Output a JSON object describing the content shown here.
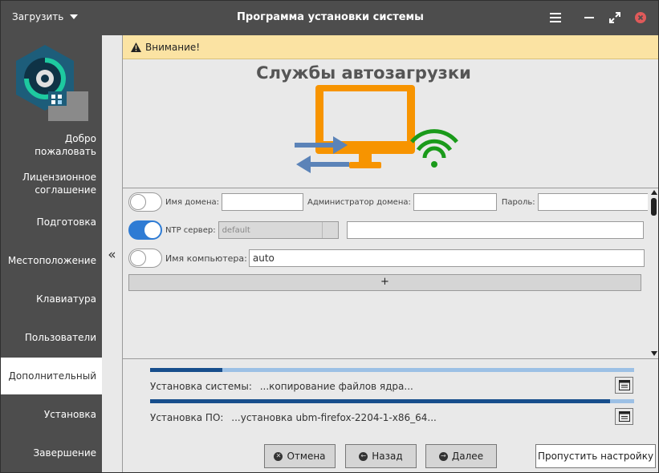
{
  "titlebar": {
    "menu_label": "Загрузить",
    "title": "Программа установки системы"
  },
  "sidebar": {
    "items": [
      {
        "label": "Добро пожаловать"
      },
      {
        "label": "Лицензионное соглашение"
      },
      {
        "label": "Подготовка"
      },
      {
        "label": "Местоположение"
      },
      {
        "label": "Клавиатура"
      },
      {
        "label": "Пользователи"
      },
      {
        "label": "Дополнительный",
        "active": true
      },
      {
        "label": "Установка"
      },
      {
        "label": "Завершение"
      }
    ],
    "collapse_glyph": "«"
  },
  "warning": {
    "text": "Внимание!"
  },
  "hero": {
    "title": "Службы автозагрузки"
  },
  "form": {
    "domain": {
      "enabled": false,
      "domain_label": "Имя домена:",
      "domain_value": "",
      "admin_label": "Администратор домена:",
      "admin_value": "",
      "password_label": "Пароль:",
      "password_value": ""
    },
    "ntp": {
      "enabled": true,
      "label": "NTP сервер:",
      "select_value": "default",
      "custom_value": ""
    },
    "hostname": {
      "enabled": false,
      "label": "Имя компьютера:",
      "value": "auto"
    },
    "add_label": "+"
  },
  "progress": {
    "system": {
      "label": "Установка системы:",
      "status": "...копирование файлов ядра...",
      "fraction": 0.15
    },
    "software": {
      "label": "Установка ПО:",
      "status": "...установка ubm-firefox-2204-1-x86_64...",
      "fraction": 0.95
    }
  },
  "buttons": {
    "cancel": "Отмена",
    "back": "Назад",
    "next": "Далее",
    "skip": "Пропустить настройку"
  },
  "colors": {
    "titlebar": "#4d4d4d",
    "accent": "#2e7bd4",
    "warning_bg": "#fbe3a3",
    "monitor": "#f79400",
    "wifi": "#1a9a1a",
    "arrows": "#5b83b8",
    "progress_fill": "#174e8c",
    "progress_track": "#9cc0e5",
    "close": "#e05a5a"
  }
}
